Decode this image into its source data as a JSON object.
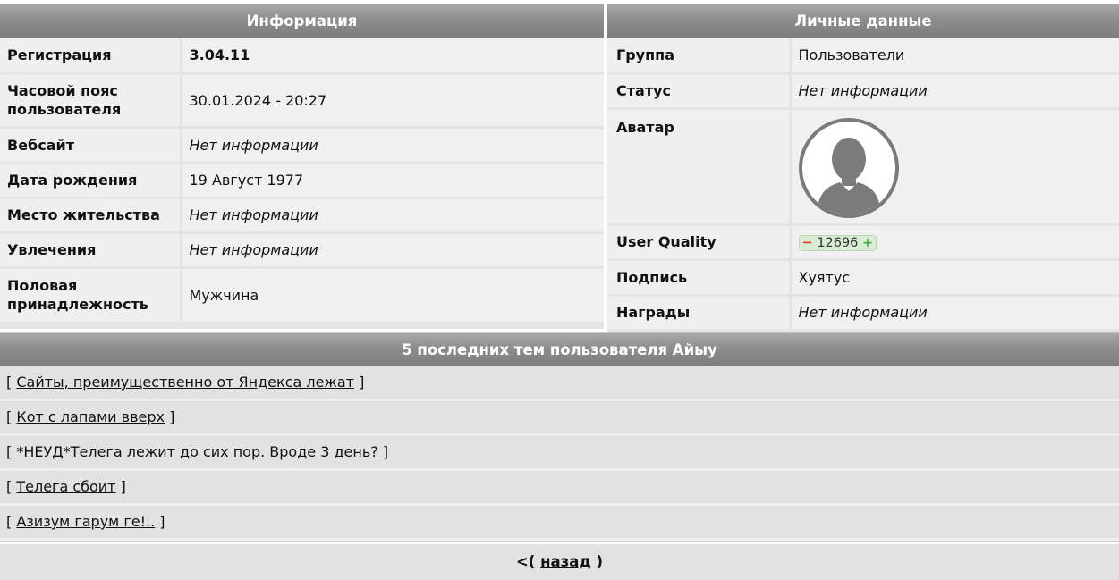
{
  "info": {
    "title": "Информация",
    "rows": [
      {
        "label": "Регистрация",
        "value": "3.04.11"
      },
      {
        "label": "Часовой пояс пользователя",
        "value": "30.01.2024 - 20:27"
      },
      {
        "label": "Вебсайт",
        "value": "Нет информации"
      },
      {
        "label": "Дата рождения",
        "value": "19 Август 1977"
      },
      {
        "label": "Место жительства",
        "value": "Нет информации"
      },
      {
        "label": "Увлечения",
        "value": "Нет информации"
      },
      {
        "label": "Половая принадлежность",
        "value": "Мужчина"
      }
    ]
  },
  "personal": {
    "title": "Личные данные",
    "group_label": "Группа",
    "group_value": "Пользователи",
    "status_label": "Статус",
    "status_value": "Нет информации",
    "avatar_label": "Аватар",
    "avatar_icon": "default-user-avatar-icon",
    "uq_label": "User Quality",
    "uq_minus": "−",
    "uq_value": "12696",
    "uq_plus": "+",
    "signature_label": "Подпись",
    "signature_value": "Хуятус",
    "awards_label": "Награды",
    "awards_value": "Нет информации"
  },
  "topics": {
    "title": "5 последних тем пользователя Айыу",
    "open_bracket": "[",
    "close_bracket": "]",
    "items": [
      "Сайты, преимущественно от Яндекса лежат",
      "Кот с лапами вверх",
      "*НЕУД*Телега лежит до сих пор. Вроде 3 день?",
      "Телега сбоит",
      "Азизум гарум ге!.."
    ]
  },
  "nav": {
    "prefix": "<(",
    "back_label": "назад",
    "suffix": ")"
  }
}
